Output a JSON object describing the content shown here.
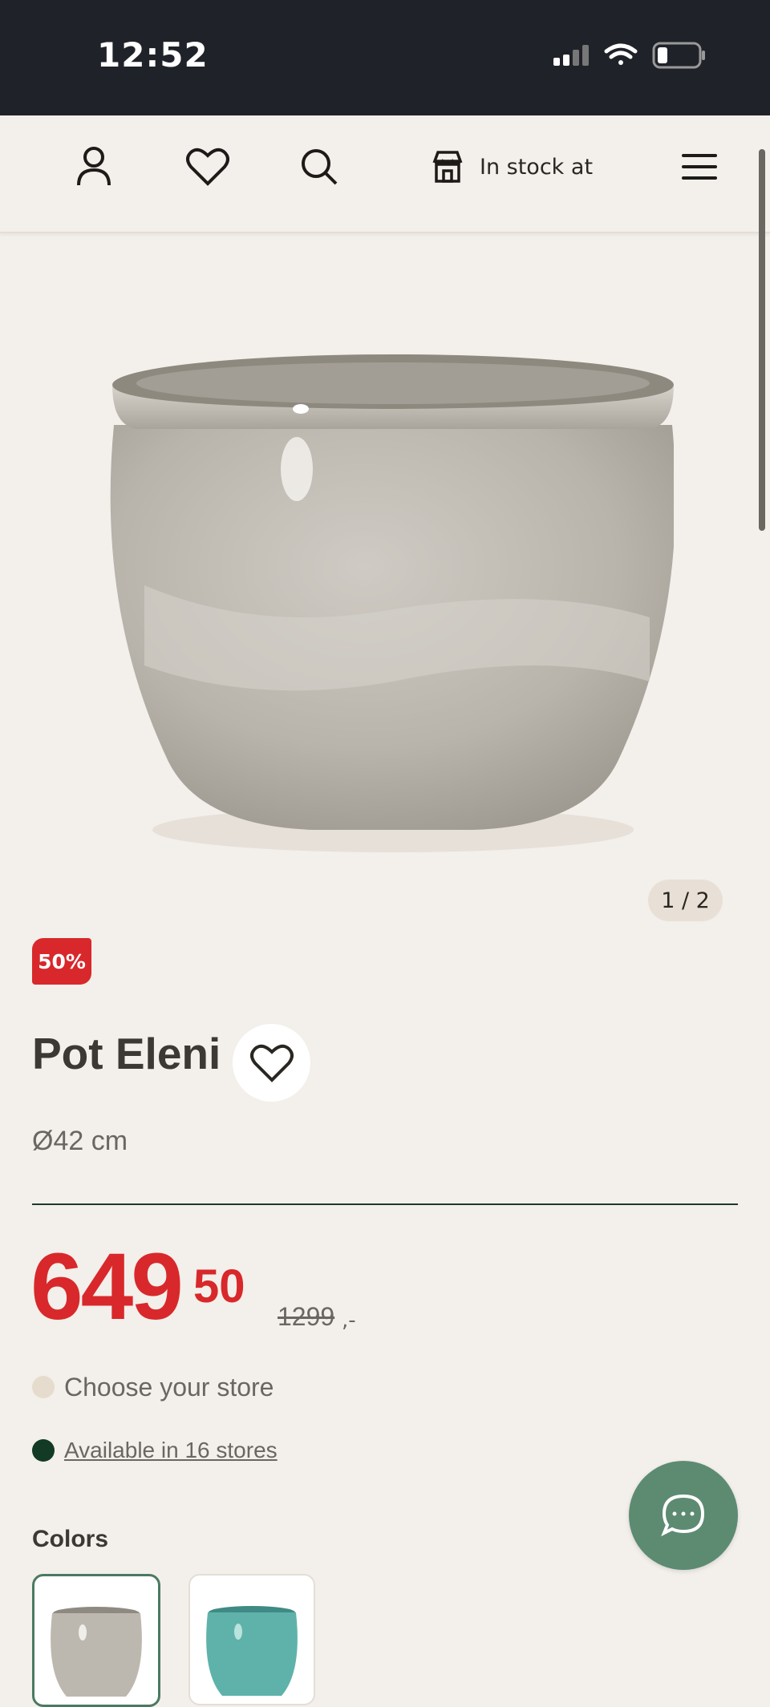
{
  "status_bar": {
    "time": "12:52"
  },
  "nav": {
    "stock_label": "In stock at",
    "icons": [
      "account-icon",
      "heart-icon",
      "search-icon",
      "store-icon",
      "menu-icon"
    ]
  },
  "gallery": {
    "counter": "1 / 2"
  },
  "product": {
    "discount_badge": "50%",
    "name": "Pot Eleni",
    "size": "Ø42 cm",
    "price_whole": "649",
    "price_cents": "50",
    "old_price": "1299",
    "old_price_suffix": ",-",
    "store_prompt": "Choose your store",
    "availability": "Available in 16 stores"
  },
  "colors": {
    "heading": "Colors"
  },
  "theme": {
    "background": "#f3efea",
    "sale_red": "#d8282b",
    "brand_green": "#1e3a2b",
    "chat_green": "#5c8b72",
    "status_dark": "#202229"
  }
}
